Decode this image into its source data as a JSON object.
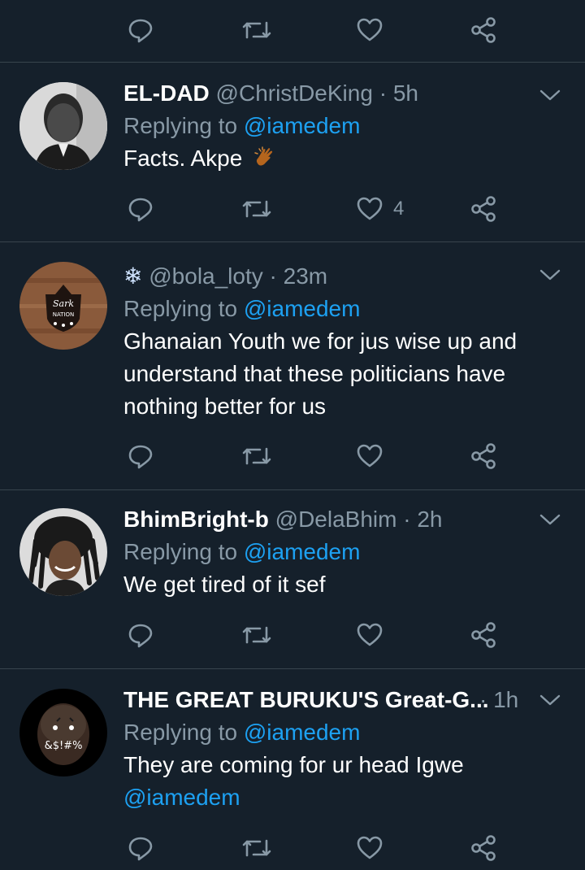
{
  "tweets": [
    {
      "name": "EL-DAD",
      "handle": "@ChristDeKing",
      "sep": " · ",
      "time": "5h",
      "replying_prefix": "Replying to ",
      "replying_to": "@iamedem",
      "text": "Facts. Akpe",
      "emoji_icon": "clapping-hands-icon",
      "like_count": "4"
    },
    {
      "name": "❄",
      "handle": "@bola_loty",
      "sep": " · ",
      "time": "23m",
      "replying_prefix": "Replying to ",
      "replying_to": "@iamedem",
      "text_lines": [
        "Ghanaian Youth we for jus wise up and",
        "understand that these politicians have",
        "nothing better for us"
      ],
      "like_count": ""
    },
    {
      "name": "BhimBright-b",
      "handle": "@DelaBhim",
      "sep": " · ",
      "time": "2h",
      "replying_prefix": "Replying to ",
      "replying_to": "@iamedem",
      "text": "We get tired of it sef",
      "like_count": ""
    },
    {
      "name": "THE GREAT BURUKU'S Great-G...",
      "handle": "",
      "sep": " · ",
      "time": "1h",
      "replying_prefix": "Replying to ",
      "replying_to": "@iamedem",
      "text": "They are coming for ur head Igwe",
      "text_mention": "@iamedem",
      "avatar_text": "&$!#%",
      "like_count": ""
    }
  ],
  "avatar_logo_lines": [
    "Sark",
    "NATION"
  ],
  "colors": {
    "background": "#15202b",
    "divider": "#38444d",
    "secondary_text": "#8899a6",
    "link": "#1da1f2",
    "icon": "#8899a6"
  },
  "icons": [
    "reply-icon",
    "retweet-icon",
    "like-icon",
    "share-icon",
    "chevron-down-icon"
  ]
}
